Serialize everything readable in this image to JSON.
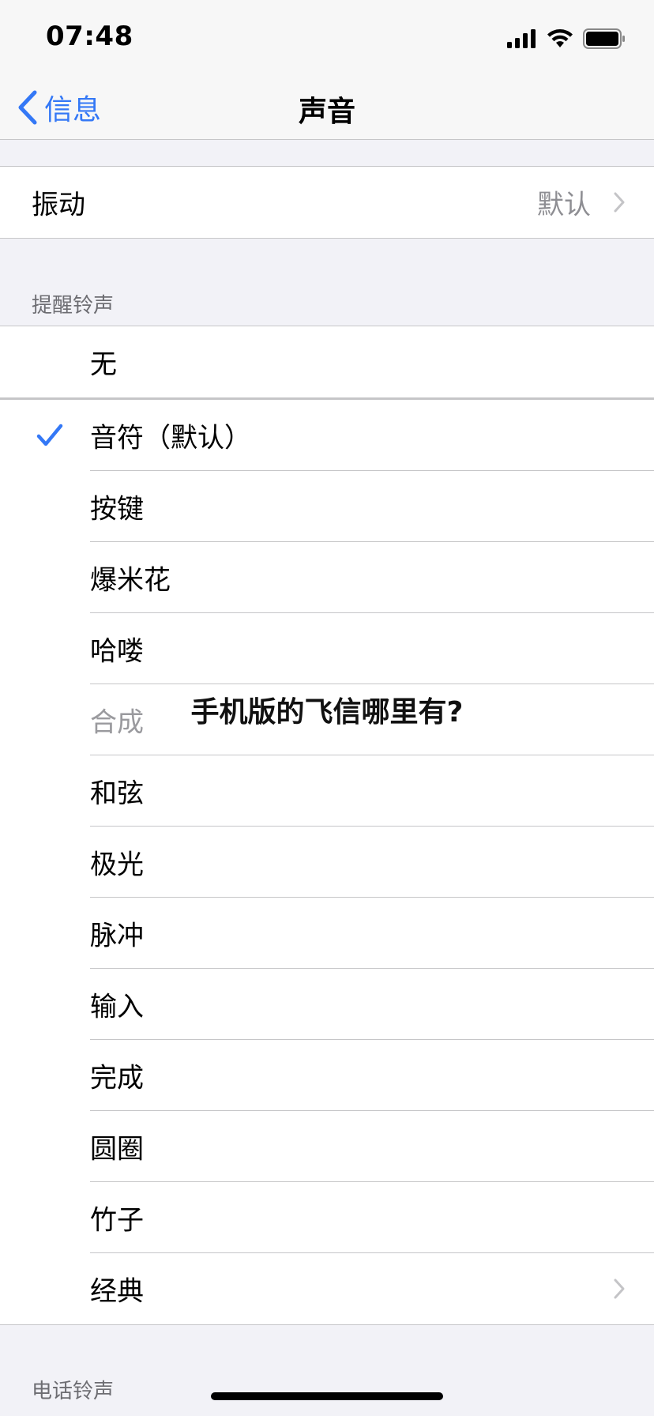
{
  "status_bar": {
    "time": "07:48"
  },
  "nav": {
    "back_label": "信息",
    "title": "声音"
  },
  "vibration": {
    "label": "振动",
    "value": "默认"
  },
  "alert_section": {
    "header": "提醒铃声",
    "none_label": "无",
    "selected_index": 0,
    "items": [
      {
        "label": "音符（默认）"
      },
      {
        "label": "按键"
      },
      {
        "label": "爆米花"
      },
      {
        "label": "哈喽"
      },
      {
        "label": "合成"
      },
      {
        "label": "和弦"
      },
      {
        "label": "极光"
      },
      {
        "label": "脉冲"
      },
      {
        "label": "输入"
      },
      {
        "label": "完成"
      },
      {
        "label": "圆圈"
      },
      {
        "label": "竹子"
      },
      {
        "label": "经典"
      }
    ]
  },
  "ringtone_section": {
    "header": "电话铃声"
  },
  "overlay": {
    "caption": "手机版的飞信哪里有?"
  },
  "colors": {
    "accent": "#3478f6",
    "secondary_text": "#8e8e93",
    "background": "#f2f2f7"
  }
}
